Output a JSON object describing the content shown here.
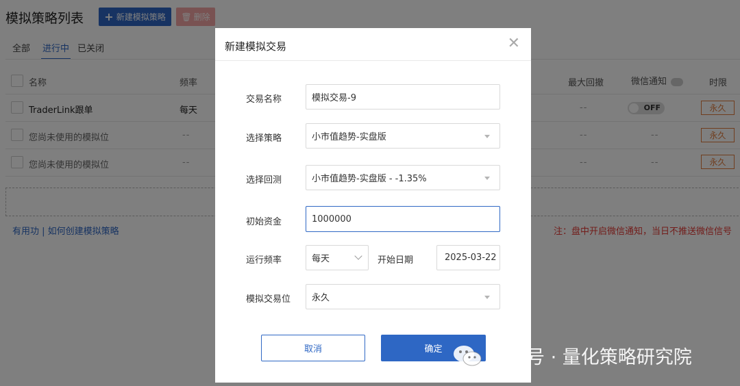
{
  "page": {
    "title": "模拟策略列表",
    "new_button": "新建模拟策略",
    "delete_button": "删除",
    "tabs": [
      "全部",
      "进行中",
      "已关闭"
    ],
    "active_tab": "进行中",
    "columns": {
      "name": "名称",
      "freq": "频率",
      "max_drawdown": "最大回撤",
      "wechat_notify": "微信通知",
      "time_limit": "时限"
    },
    "rows": [
      {
        "name": "TraderLink跟单",
        "freq": "每天",
        "drawdown": "--",
        "wechat": "OFF",
        "limit": "永久"
      },
      {
        "name": "您尚未使用的模拟位",
        "freq": "--",
        "drawdown": "--",
        "wechat": "--",
        "limit": "永久"
      },
      {
        "name": "您尚未使用的模拟位",
        "freq": "--",
        "drawdown": "--",
        "wechat": "--",
        "limit": "永久"
      }
    ],
    "help_link": "有用功 | 如何创建模拟策略",
    "notice": "注：盘中开启微信通知，当日不推送微信信号"
  },
  "modal": {
    "title": "新建模拟交易",
    "fields": {
      "name_label": "交易名称",
      "name_value": "模拟交易-9",
      "strategy_label": "选择策略",
      "strategy_value": "小市值趋势-实盘版",
      "backtest_label": "选择回测",
      "backtest_value": "小市值趋势-实盘版 - -1.35%",
      "capital_label": "初始资金",
      "capital_value": "1000000",
      "freq_label": "运行频率",
      "freq_value": "每天",
      "start_label": "开始日期",
      "start_value": "2025-03-22",
      "slot_label": "模拟交易位",
      "slot_value": "永久"
    },
    "cancel_button": "取消",
    "ok_button": "确定"
  },
  "watermark": "公众号 · 量化策略研究院",
  "colors": {
    "primary": "#2e67c4",
    "danger": "#e53935",
    "tag_orange": "#e07a3a"
  }
}
